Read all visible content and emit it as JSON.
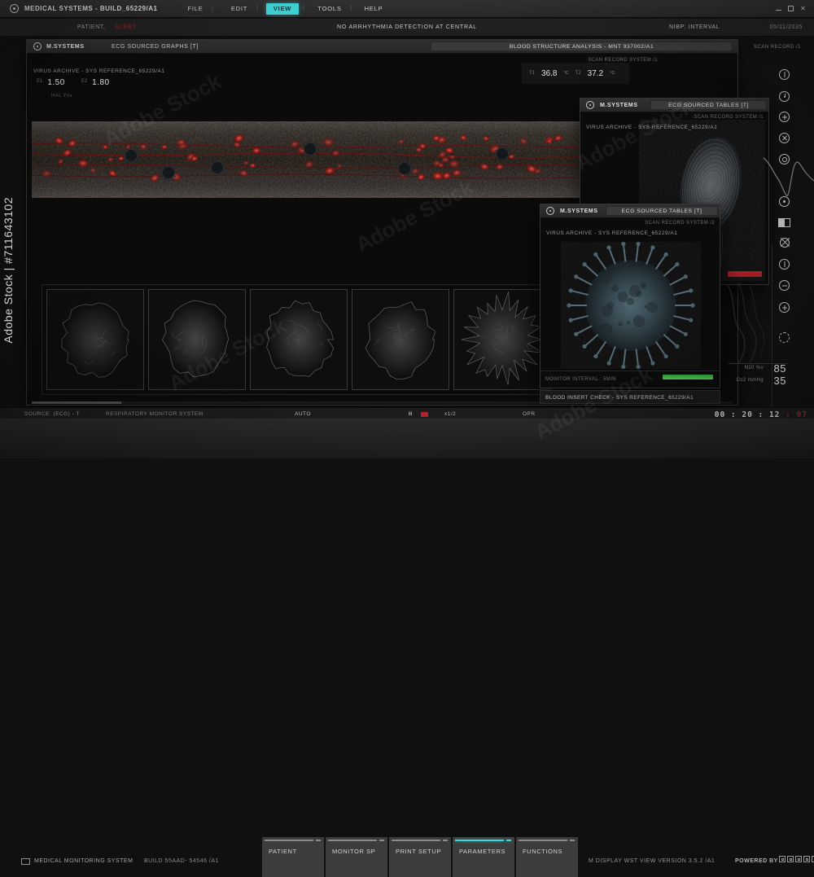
{
  "titlebar": {
    "app_title": "MEDICAL SYSTEMS - BUILD_65229/A1",
    "menus": [
      "FILE",
      "EDIT",
      "VIEW",
      "TOOLS",
      "HELP"
    ],
    "active_menu": "VIEW",
    "window_controls": [
      "minimize-icon",
      "maximize-icon",
      "close-icon"
    ]
  },
  "infobar": {
    "patient_label": "PATIENT,",
    "patient_value": "ALERT",
    "status_message": "NO ARRHYTHMIA DETECTION AT CENTRAL",
    "nibp": "NIBP: INTERVAL",
    "date": "05/11/2035"
  },
  "graphs_window": {
    "system": "M.SYSTEMS",
    "tab_title": "ECG SOURCED GRAPHS [T]",
    "analysis_title": "BLOOD STRUCTURE ANALYSIS - MNT 937002/A1",
    "scan_record_system": "SCAN RECORD SYSTEM /1",
    "archive_title": "VIRUS ARCHIVE - SYS REFERENCE_65229/A1",
    "e1_label": "E1",
    "e1_value": "1.50",
    "e2_label": "E2",
    "e2_value": "1.80",
    "hal_label": "HAL Yxv",
    "t1_label": "T1",
    "t1_value": "36.8",
    "t2_label": "T2",
    "t2_value": "37.2",
    "temp_unit": "°C"
  },
  "tables_window_top": {
    "system": "M.SYSTEMS",
    "tab_title": "ECG SOURCED TABLES [T]",
    "scan_record_system": "SCAN RECORD SYSTEM /1",
    "archive_title": "VIRUS ARCHIVE - SYS REFERENCE_65229/A1"
  },
  "tables_window_front": {
    "system": "M.SYSTEMS",
    "tab_title": "ECG SOURCED TABLES [T]",
    "scan_record_system": "SCAN RECORD SYSTEM /2",
    "archive_title": "VIRUS ARCHIVE - SYS REFERENCE_65229/A1",
    "monitor_interval": "MONITOR INTERVAL : 5MIN",
    "footer_label": "BLOOD INSERT CHECK - SYS REFERENCE_65229/A1"
  },
  "right_panel": {
    "scan_record": "SCAN RECORD /1",
    "n2o_label": "N20 %v",
    "n2o_value": "85",
    "co2_label": "Co2 mmHg",
    "co2_value": "35",
    "icons": [
      "contrast-icon",
      "history-icon",
      "zoom-in-icon",
      "close-circle-icon",
      "record-ring-icon",
      "target-dot-icon",
      "split-view-icon",
      "signal-blocked-icon",
      "contrast-icon",
      "minus-circle-icon",
      "plus-circle-icon",
      "segment-circle-icon"
    ]
  },
  "statusbar": {
    "source_label": "SOURCE: (ECG) - T",
    "system_label": "RESPIRATORY MONITOR SYSTEM",
    "auto_label": "AUTO",
    "pause_label": "II",
    "speed_label": "x1/2",
    "opr_label": "OPR",
    "timecode": "00 : 20 : 12",
    "timecode_frames": " : 07"
  },
  "bottombar": {
    "system_name": "MEDICAL MONITORING SYSTEM",
    "build_label": "BUILD 55AAD- 54546 /A1",
    "tabs": [
      {
        "label": "PATIENT",
        "active": false
      },
      {
        "label": "MONITOR SP",
        "active": false
      },
      {
        "label": "PRINT SETUP",
        "active": false
      },
      {
        "label": "PARAMETERS",
        "active": true
      },
      {
        "label": "FUNCTIONS",
        "active": false
      }
    ],
    "version_label": "M DISPLAY WST VIEW  VERSION 3.5.2 /A1",
    "powered_by": "POWERED BY"
  },
  "watermark": {
    "vertical_text": "Adobe Stock | #711643102",
    "diagonal_text": "Adobe Stock"
  },
  "colors": {
    "accent_cyan": "#3fd6d9",
    "alert_red": "#b3232a",
    "progress_green": "#43b64a"
  }
}
